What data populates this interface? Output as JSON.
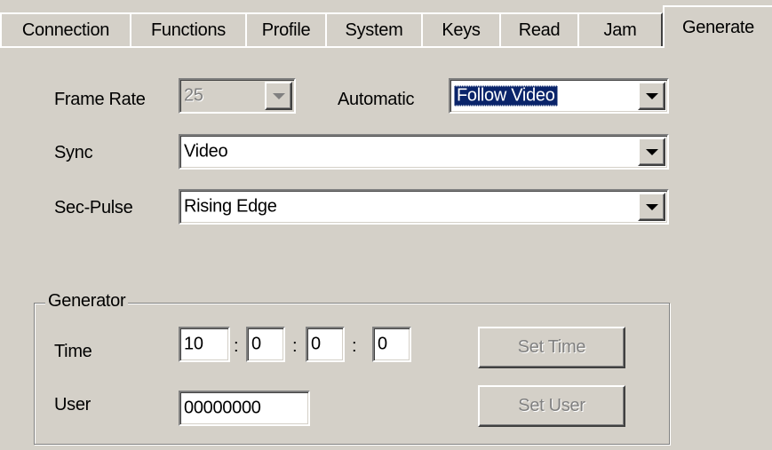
{
  "tabs": [
    {
      "label": "Connection"
    },
    {
      "label": "Functions"
    },
    {
      "label": "Profile"
    },
    {
      "label": "System"
    },
    {
      "label": "Keys"
    },
    {
      "label": "Read"
    },
    {
      "label": "Jam"
    },
    {
      "label": "Generate"
    }
  ],
  "active_tab": "Generate",
  "frame_rate": {
    "label": "Frame Rate",
    "value": "25",
    "enabled": false
  },
  "automatic": {
    "label": "Automatic",
    "value": "Follow Video"
  },
  "sync": {
    "label": "Sync",
    "value": "Video"
  },
  "sec_pulse": {
    "label": "Sec-Pulse",
    "value": "Rising Edge"
  },
  "generator": {
    "title": "Generator",
    "time_label": "Time",
    "time": {
      "hours": "10",
      "minutes": "0",
      "seconds": "0",
      "frames": "0",
      "separator": ":"
    },
    "set_time_label": "Set Time",
    "user_label": "User",
    "user_value": "00000000",
    "set_user_label": "Set User"
  }
}
